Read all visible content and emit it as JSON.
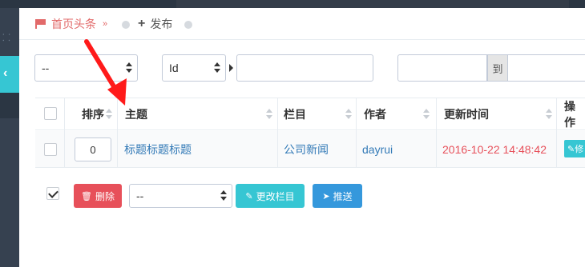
{
  "tabs": {
    "home_label": "首页头条",
    "publish_label": "发布"
  },
  "filters": {
    "select1_value": "--",
    "field_select_value": "Id",
    "range_separator": "到"
  },
  "table": {
    "headers": {
      "order": "排序",
      "title": "主题",
      "category": "栏目",
      "author": "作者",
      "updated": "更新时间",
      "actions": "操作"
    },
    "rows": [
      {
        "order": "0",
        "title": "标题标题标题",
        "category": "公司新闻",
        "author": "dayrui",
        "updated": "2016-10-22 14:48:42",
        "edit_label": "修"
      }
    ]
  },
  "actions": {
    "delete_label": "删除",
    "category_select_value": "--",
    "change_category_label": "更改栏目",
    "push_label": "推送"
  },
  "colors": {
    "accent_teal": "#36c6d3",
    "danger": "#e7505a",
    "primary": "#3598dc",
    "date_red": "#e7505a",
    "tab_active": "#e26a6a"
  }
}
